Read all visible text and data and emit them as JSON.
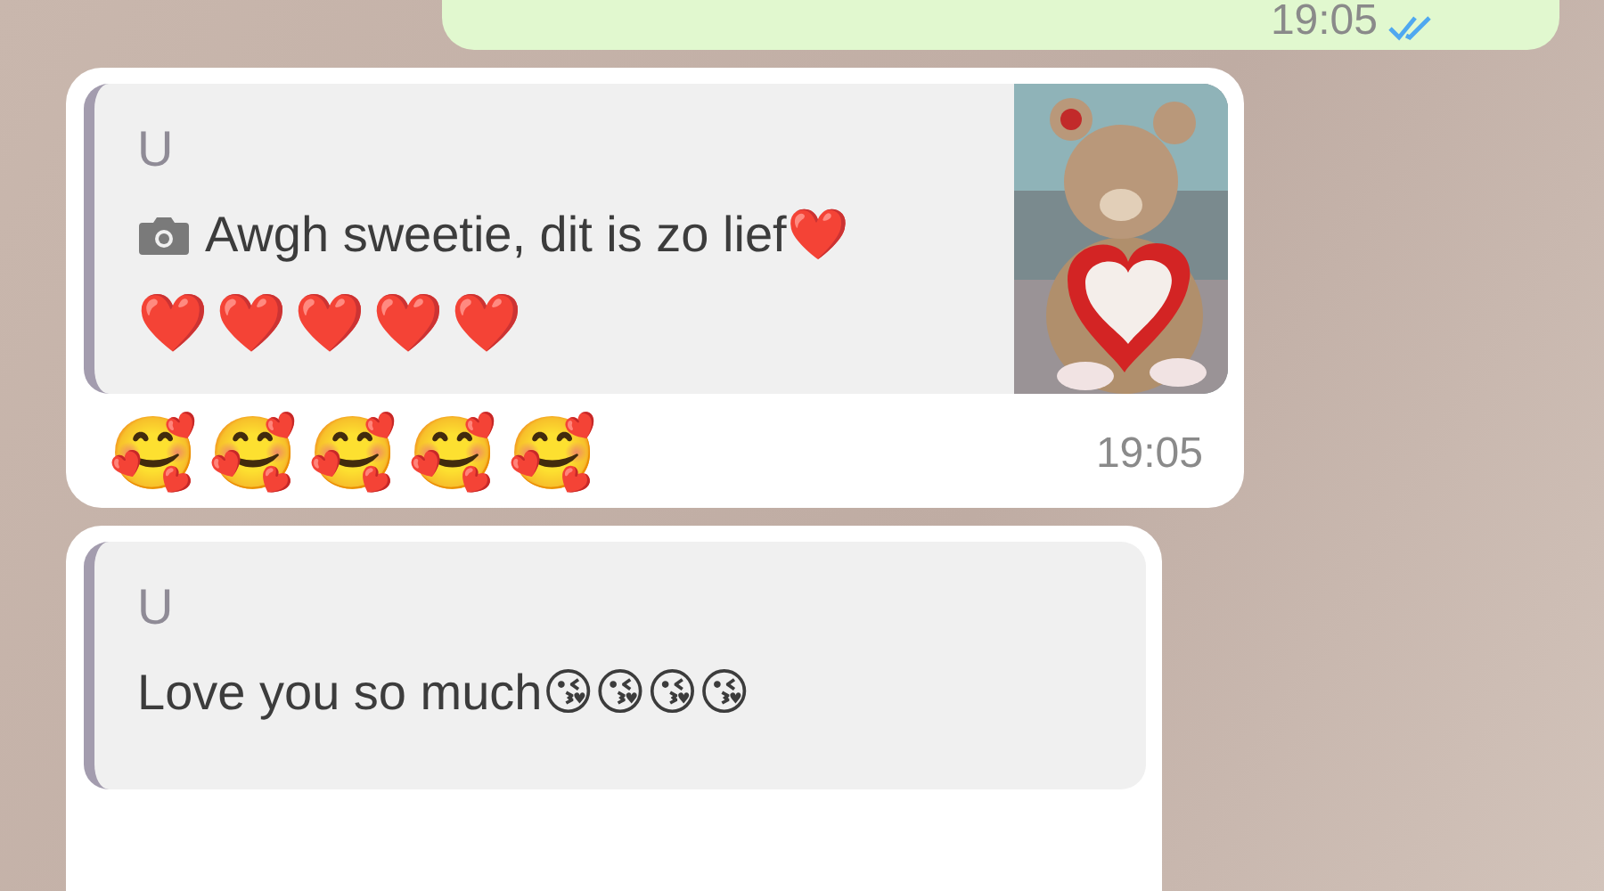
{
  "messages": [
    {
      "kind": "outgoing",
      "time": "19:05",
      "read": true
    },
    {
      "kind": "incoming",
      "quote": {
        "author": "U",
        "has_photo": true,
        "text": "Awgh sweetie, dit is zo lief❤️",
        "extra": "❤️❤️❤️❤️❤️"
      },
      "text": "🥰🥰🥰🥰🥰",
      "time": "19:05"
    },
    {
      "kind": "incoming",
      "quote": {
        "author": "U",
        "has_photo": false,
        "text": "Love you so much😘😘😘😘"
      }
    }
  ]
}
